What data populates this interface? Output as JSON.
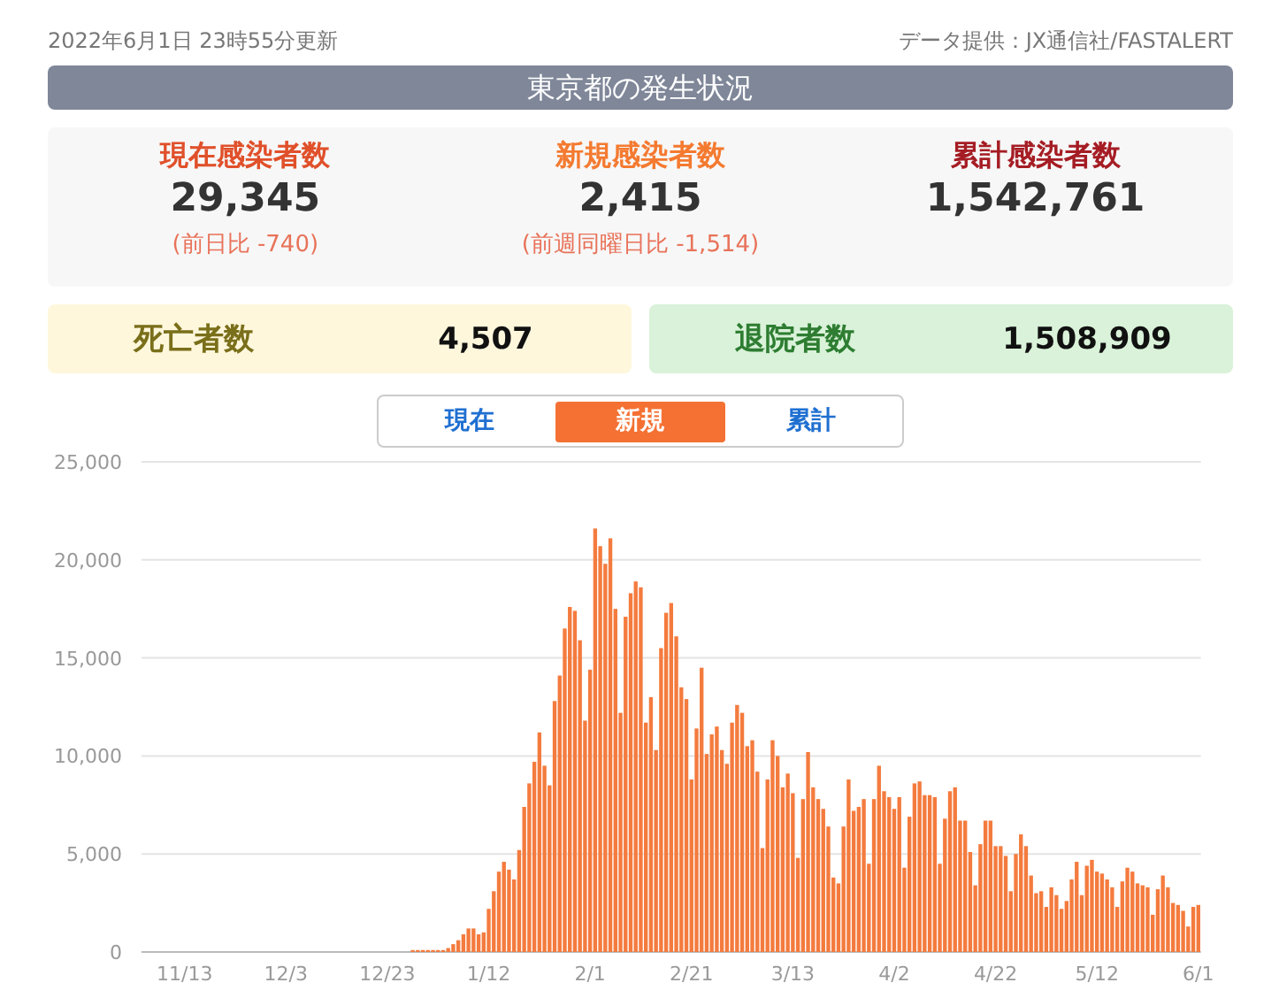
{
  "updated": "2022年6月1日 23時55分更新",
  "source": "データ提供：JX通信社/FASTALERT",
  "title": "東京都の発生状況",
  "stats": [
    {
      "kind": "current",
      "label": "現在感染者数",
      "value": "29,345",
      "note": "(前日比 -740)"
    },
    {
      "kind": "new",
      "label": "新規感染者数",
      "value": "2,415",
      "note": "(前週同曜日比 -1,514)"
    },
    {
      "kind": "total",
      "label": "累計感染者数",
      "value": "1,542,761"
    }
  ],
  "outcomes": [
    {
      "kind": "deaths",
      "label": "死亡者数",
      "value": "4,507"
    },
    {
      "kind": "discharged",
      "label": "退院者数",
      "value": "1,508,909"
    }
  ],
  "tabs": [
    {
      "label": "現在",
      "selected": false
    },
    {
      "label": "新規",
      "selected": true
    },
    {
      "label": "累計",
      "selected": false
    }
  ],
  "chart_data": {
    "type": "bar",
    "grid": true,
    "categories": [
      null,
      null,
      null,
      null,
      null,
      null,
      null,
      null,
      "11/13",
      null,
      null,
      null,
      null,
      null,
      null,
      null,
      null,
      null,
      null,
      null,
      null,
      null,
      null,
      null,
      null,
      null,
      null,
      null,
      "12/3",
      null,
      null,
      null,
      null,
      null,
      null,
      null,
      null,
      null,
      null,
      null,
      null,
      null,
      null,
      null,
      null,
      null,
      null,
      null,
      "12/23",
      null,
      null,
      null,
      null,
      null,
      null,
      null,
      null,
      null,
      null,
      null,
      null,
      null,
      null,
      null,
      null,
      null,
      null,
      null,
      "1/12",
      null,
      null,
      null,
      null,
      null,
      null,
      null,
      null,
      null,
      null,
      null,
      null,
      null,
      null,
      null,
      null,
      null,
      null,
      null,
      "2/1",
      null,
      null,
      null,
      null,
      null,
      null,
      null,
      null,
      null,
      null,
      null,
      null,
      null,
      null,
      null,
      null,
      null,
      null,
      null,
      "2/21",
      null,
      null,
      null,
      null,
      null,
      null,
      null,
      null,
      null,
      null,
      null,
      null,
      null,
      null,
      null,
      null,
      null,
      null,
      null,
      "3/13",
      null,
      null,
      null,
      null,
      null,
      null,
      null,
      null,
      null,
      null,
      null,
      null,
      null,
      null,
      null,
      null,
      null,
      null,
      null,
      "4/2",
      null,
      null,
      null,
      null,
      null,
      null,
      null,
      null,
      null,
      null,
      null,
      null,
      null,
      null,
      null,
      null,
      null,
      null,
      null,
      "4/22",
      null,
      null,
      null,
      null,
      null,
      null,
      null,
      null,
      null,
      null,
      null,
      null,
      null,
      null,
      null,
      null,
      null,
      null,
      null,
      "5/12",
      null,
      null,
      null,
      null,
      null,
      null,
      null,
      null,
      null,
      null,
      null,
      null,
      null,
      null,
      null,
      null,
      null,
      null,
      null,
      "6/1"
    ],
    "series": [
      {
        "color": "#f47b3e",
        "values": [
          0,
          0,
          0,
          0,
          0,
          0,
          0,
          0,
          0,
          0,
          0,
          0,
          0,
          0,
          0,
          0,
          0,
          0,
          0,
          0,
          0,
          0,
          0,
          0,
          0,
          0,
          0,
          0,
          0,
          0,
          0,
          0,
          0,
          0,
          0,
          0,
          0,
          0,
          0,
          0,
          0,
          0,
          0,
          0,
          0,
          0,
          0,
          0,
          0,
          0,
          0,
          0,
          0,
          100,
          100,
          100,
          100,
          100,
          100,
          100,
          200,
          400,
          600,
          900,
          1200,
          1200,
          900,
          1000,
          2200,
          3100,
          4100,
          4600,
          4200,
          3700,
          5200,
          7400,
          8600,
          9700,
          11200,
          9500,
          8500,
          12800,
          14100,
          16500,
          17600,
          17400,
          15900,
          11800,
          14400,
          21600,
          20700,
          19800,
          21100,
          17500,
          12200,
          17100,
          18300,
          18900,
          18600,
          11700,
          13000,
          10300,
          15500,
          17300,
          17800,
          16100,
          13500,
          12900,
          8800,
          11400,
          14500,
          10100,
          11100,
          11500,
          10300,
          9600,
          11700,
          12600,
          12200,
          10500,
          10800,
          9200,
          5300,
          8800,
          10800,
          10000,
          8400,
          9100,
          8100,
          4800,
          7800,
          10200,
          8400,
          7800,
          7300,
          6400,
          3800,
          3500,
          6400,
          8800,
          7200,
          7400,
          7800,
          4500,
          7800,
          9500,
          8200,
          7900,
          7300,
          7900,
          4300,
          6900,
          8600,
          8700,
          8000,
          8000,
          7900,
          4500,
          6800,
          8200,
          8400,
          6700,
          6700,
          5100,
          3400,
          5500,
          6700,
          6700,
          5400,
          5400,
          4900,
          3100,
          5000,
          6000,
          5400,
          3900,
          3000,
          3100,
          2300,
          3300,
          2900,
          2200,
          2600,
          3700,
          4600,
          2900,
          4400,
          4700,
          4100,
          4000,
          3700,
          3300,
          2300,
          3600,
          4300,
          4100,
          3500,
          3400,
          3300,
          1900,
          3200,
          3900,
          3300,
          2500,
          2400,
          2100,
          1300,
          2300,
          2400
        ]
      }
    ],
    "ylim": [
      0,
      25000
    ],
    "yticks": [
      {
        "value": 0,
        "label": "0"
      },
      {
        "value": 5000,
        "label": "5,000"
      },
      {
        "value": 10000,
        "label": "10,000"
      },
      {
        "value": 15000,
        "label": "15,000"
      },
      {
        "value": 20000,
        "label": "20,000"
      },
      {
        "value": 25000,
        "label": "25,000"
      }
    ]
  }
}
